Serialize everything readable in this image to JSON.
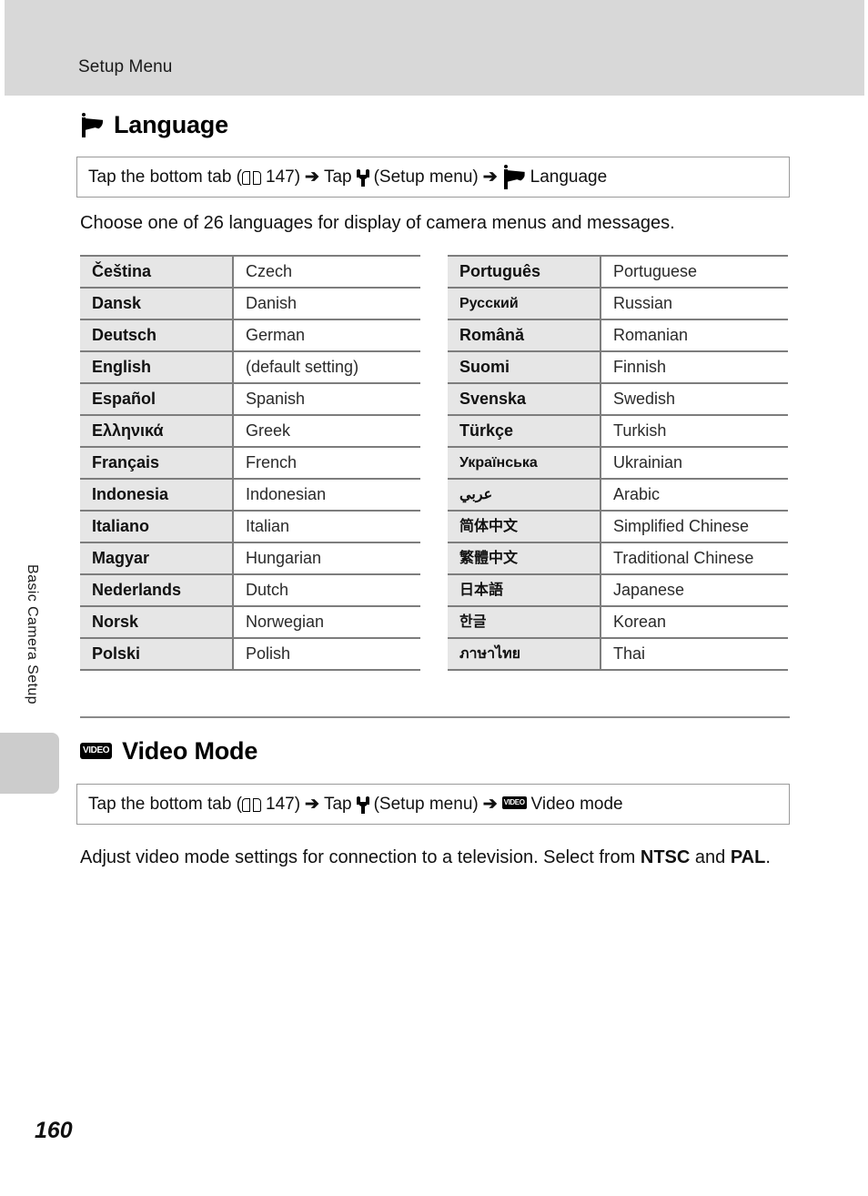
{
  "header": {
    "title": "Setup Menu"
  },
  "sidebar": {
    "chapter_label": "Basic Camera Setup"
  },
  "footer": {
    "page_number": "160"
  },
  "language_section": {
    "icon": "flag-icon",
    "heading": "Language",
    "instruction": {
      "part1": "Tap the bottom tab (",
      "book_icon": "book-icon",
      "page_ref": "147)",
      "arrow1": "➔",
      "part2": "Tap",
      "wrench_icon": "wrench-icon",
      "part3": "(Setup menu)",
      "arrow2": "➔",
      "flag_icon": "flag-icon",
      "part4": "Language"
    },
    "description": "Choose one of 26 languages for display of camera menus and messages.",
    "left_table": [
      {
        "native": "Čeština",
        "english": "Czech"
      },
      {
        "native": "Dansk",
        "english": "Danish"
      },
      {
        "native": "Deutsch",
        "english": "German"
      },
      {
        "native": "English",
        "english": "(default setting)"
      },
      {
        "native": "Español",
        "english": "Spanish"
      },
      {
        "native": "Ελληνικά",
        "english": "Greek"
      },
      {
        "native": "Français",
        "english": "French"
      },
      {
        "native": "Indonesia",
        "english": "Indonesian"
      },
      {
        "native": "Italiano",
        "english": "Italian"
      },
      {
        "native": "Magyar",
        "english": "Hungarian"
      },
      {
        "native": "Nederlands",
        "english": "Dutch"
      },
      {
        "native": "Norsk",
        "english": "Norwegian"
      },
      {
        "native": "Polski",
        "english": "Polish"
      }
    ],
    "right_table": [
      {
        "native": "Português",
        "english": "Portuguese"
      },
      {
        "native": "Русский",
        "english": "Russian"
      },
      {
        "native": "Română",
        "english": "Romanian"
      },
      {
        "native": "Suomi",
        "english": "Finnish"
      },
      {
        "native": "Svenska",
        "english": "Swedish"
      },
      {
        "native": "Türkçe",
        "english": "Turkish"
      },
      {
        "native": "Українська",
        "english": "Ukrainian"
      },
      {
        "native": "عربي",
        "english": "Arabic"
      },
      {
        "native": "简体中文",
        "english": "Simplified Chinese"
      },
      {
        "native": "繁體中文",
        "english": "Traditional Chinese"
      },
      {
        "native": "日本語",
        "english": "Japanese"
      },
      {
        "native": "한글",
        "english": "Korean"
      },
      {
        "native": "ภาษาไทย",
        "english": "Thai"
      }
    ]
  },
  "video_section": {
    "icon": "video-icon",
    "icon_text": "VIDEO",
    "heading": "Video Mode",
    "instruction": {
      "part1": "Tap the bottom tab (",
      "book_icon": "book-icon",
      "page_ref": "147)",
      "arrow1": "➔",
      "part2": "Tap",
      "wrench_icon": "wrench-icon",
      "part3": "(Setup menu)",
      "arrow2": "➔",
      "video_icon": "video-icon",
      "part4": "Video mode"
    },
    "description_part1": "Adjust video mode settings for connection to a television. Select from ",
    "description_bold1": "NTSC",
    "description_part2": " and ",
    "description_bold2": "PAL",
    "description_part3": "."
  },
  "colors": {
    "header_band": "#d8d8d8",
    "side_tab": "#cccccc",
    "table_native_bg": "#e6e6e6",
    "table_rule": "#7d7d7d"
  }
}
